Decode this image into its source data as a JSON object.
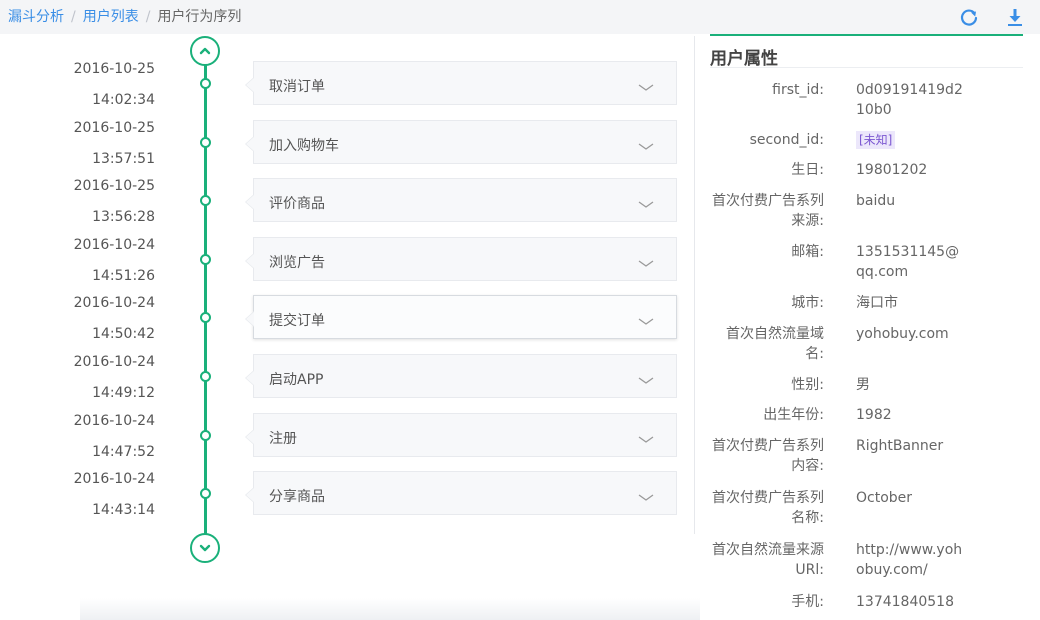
{
  "breadcrumb": {
    "items": [
      "漏斗分析",
      "用户列表"
    ],
    "separator": "/",
    "current": "用户行为序列"
  },
  "toolbar": {
    "refresh_icon": "refresh-icon",
    "download_icon": "download-icon",
    "accent_color": "#3a8ee6"
  },
  "timeline": {
    "accent_color": "#1ab07a",
    "scroll_up_icon": "chevron-up-icon",
    "scroll_down_icon": "chevron-down-icon",
    "events": [
      {
        "date": "2016-10-25",
        "time": "14:02:34",
        "name": "取消订单"
      },
      {
        "date": "2016-10-25",
        "time": "13:57:51",
        "name": "加入购物车"
      },
      {
        "date": "2016-10-25",
        "time": "13:56:28",
        "name": "评价商品"
      },
      {
        "date": "2016-10-24",
        "time": "14:51:26",
        "name": "浏览广告"
      },
      {
        "date": "2016-10-24",
        "time": "14:50:42",
        "name": "提交订单",
        "active": true
      },
      {
        "date": "2016-10-24",
        "time": "14:49:12",
        "name": "启动APP"
      },
      {
        "date": "2016-10-24",
        "time": "14:47:52",
        "name": "注册"
      },
      {
        "date": "2016-10-24",
        "time": "14:43:14",
        "name": "分享商品"
      }
    ]
  },
  "properties": {
    "title": "用户属性",
    "items": [
      {
        "key": "first_id:",
        "value": "0d09191419d210b0"
      },
      {
        "key": "second_id:",
        "value": "[未知]",
        "tag": true
      },
      {
        "key": "生日:",
        "value": "19801202"
      },
      {
        "key": "首次付费广告系列来源:",
        "value": "baidu"
      },
      {
        "key": "邮箱:",
        "value": "1351531145@qq.com"
      },
      {
        "key": "城市:",
        "value": "海口市"
      },
      {
        "key": "首次自然流量域名:",
        "value": "yohobuy.com"
      },
      {
        "key": "性别:",
        "value": "男"
      },
      {
        "key": "出生年份:",
        "value": "1982"
      },
      {
        "key": "首次付费广告系列内容:",
        "value": "RightBanner"
      },
      {
        "key": "首次付费广告系列名称:",
        "value": "October"
      },
      {
        "key": "首次自然流量来源URl:",
        "value": "http://www.yohobuy.com/"
      },
      {
        "key": "手机:",
        "value": "13741840518"
      }
    ]
  }
}
